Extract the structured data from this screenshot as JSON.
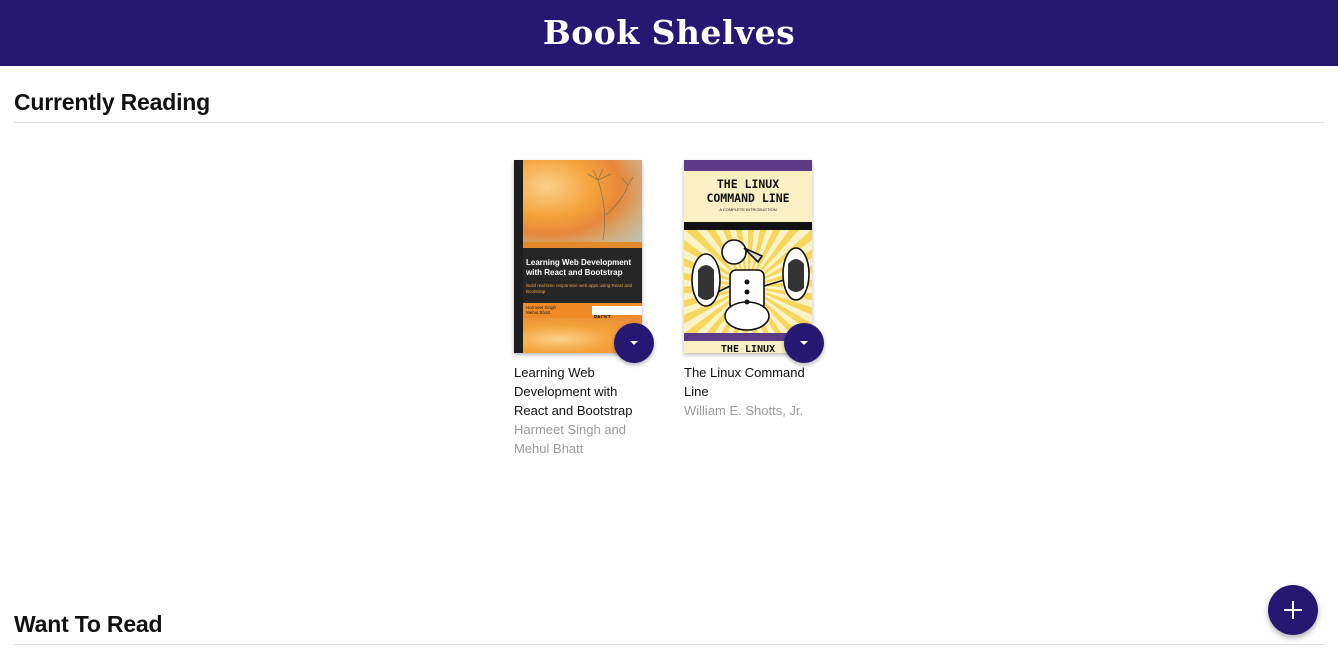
{
  "header": {
    "title": "Book Shelves"
  },
  "shelves": [
    {
      "title": "Currently Reading",
      "books": [
        {
          "title": "Learning Web Development with React and Bootstrap",
          "authors": "Harmeet Singh and Mehul Bhatt",
          "cover": {
            "title": "Learning Web Development with React and Bootstrap",
            "subtitle": "Build real-time responsive web apps using React and Bootstrap",
            "author_lines": [
              "Harmeet Singh",
              "Mehul Bhatt"
            ],
            "publisher": "PACKT"
          }
        },
        {
          "title": "The Linux Command Line",
          "authors": "William E. Shotts, Jr.",
          "cover": {
            "title_line1": "THE LINUX",
            "title_line2": "COMMAND LINE",
            "subtitle": "A COMPLETE INTRODUCTION",
            "bottom_text": "THE LINUX"
          }
        }
      ]
    },
    {
      "title": "Want To Read",
      "books": []
    }
  ],
  "icons": {
    "shelf_changer": "caret-down-icon",
    "add": "plus-icon"
  },
  "colors": {
    "header": "#261872",
    "button": "#261872"
  }
}
